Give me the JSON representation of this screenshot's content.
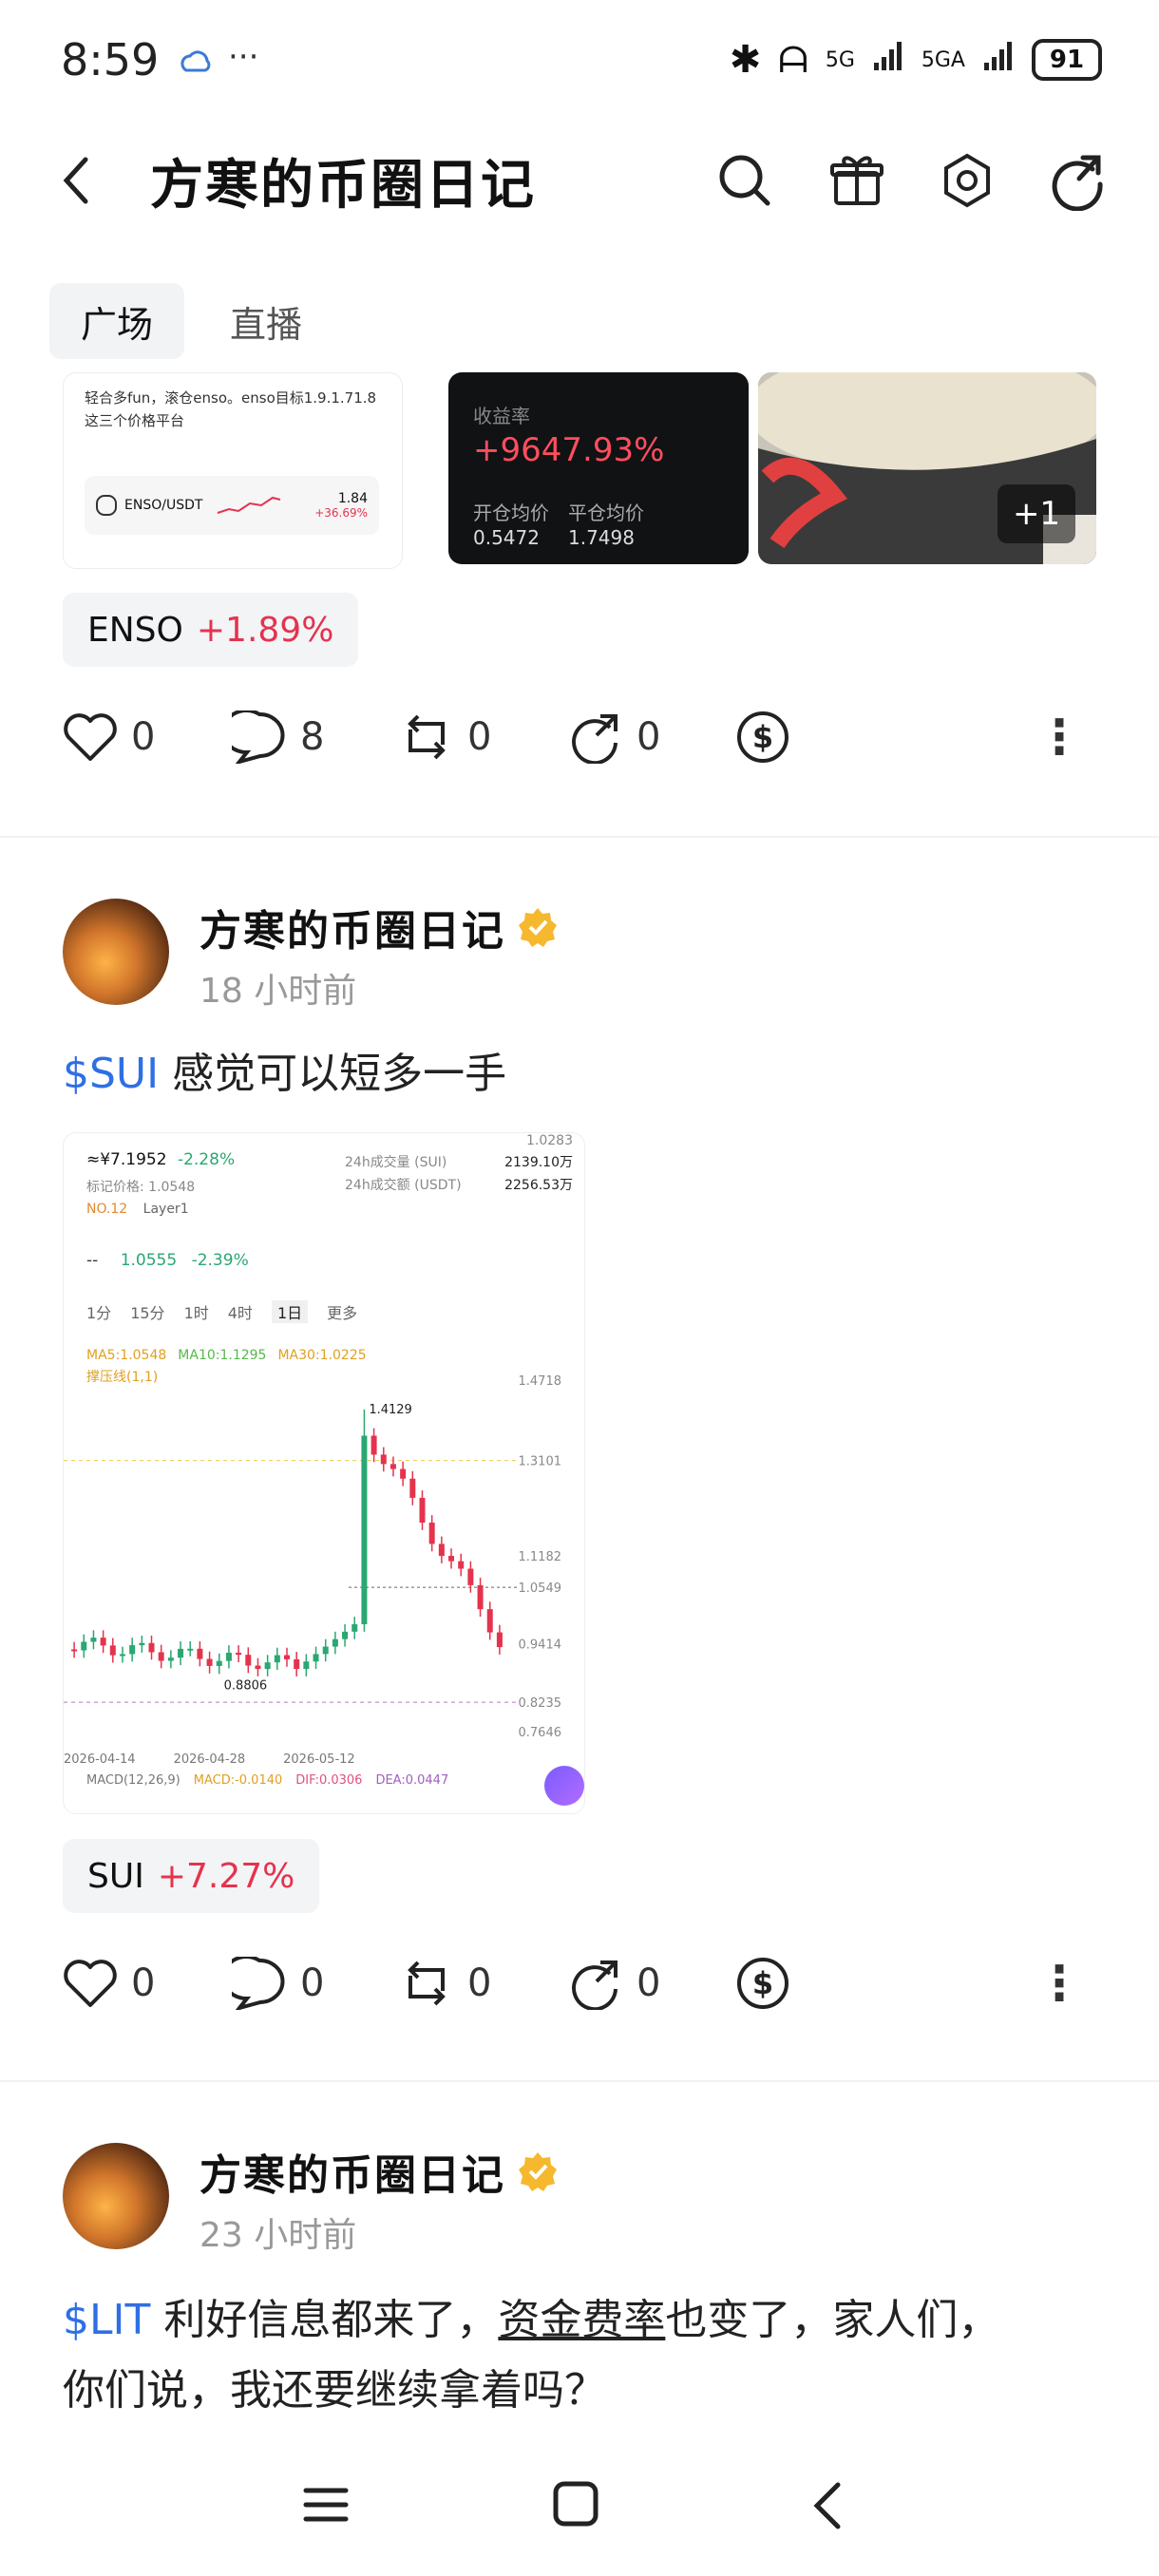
{
  "status_bar": {
    "time": "8:59",
    "more": "···",
    "network1": "5G",
    "network2": "5GA",
    "battery": "91"
  },
  "header": {
    "title": "方寒的币圈日记"
  },
  "tabs": [
    {
      "label": "广场"
    },
    {
      "label": "直播"
    }
  ],
  "post1": {
    "thumb1": {
      "line1": "轻合多fun，滚仓enso。enso目标1.9.1.71.8这三个价格平台",
      "pair": "ENSO/USDT",
      "price": "1.84",
      "change": "+36.69%"
    },
    "thumb2": {
      "label": "收益率",
      "value": "+9647.93%",
      "open_label": "开仓均价",
      "open_value": "0.5472",
      "close_label": "平仓均价",
      "close_value": "1.7498"
    },
    "thumb3": {
      "more": "+1"
    },
    "ticker": {
      "symbol": "ENSO",
      "change": "+1.89%"
    },
    "actions": {
      "likes": "0",
      "comments": "8",
      "reposts": "0",
      "shares": "0"
    }
  },
  "post2": {
    "author": "方寒的币圈日记",
    "time": "18 小时前",
    "cashtag": "$SUI",
    "text": " 感觉可以短多一手",
    "chart": {
      "price_cny": "≈¥7.1952",
      "change": "-2.28%",
      "mark_price": "标记价格: 1.0548",
      "rank": "NO.12",
      "sector": "Layer1",
      "stats": [
        {
          "label": "24h成交量 (SUI)",
          "value": "2139.10万"
        },
        {
          "label": "24h成交额 (USDT)",
          "value": "2256.53万"
        }
      ],
      "stat_top": "1.0283",
      "quote": "1.0555",
      "quote_change": "-2.39%",
      "intervals": [
        "1分",
        "15分",
        "1时",
        "4时",
        "1日",
        "更多"
      ],
      "ma": {
        "ma5": "MA5:1.0548",
        "ma10": "MA10:1.1295",
        "ma30": "MA30:1.0225",
        "sr": "撑压线(1,1)"
      },
      "high_label": "1.4129",
      "low_label": "0.8806",
      "yticks": [
        "1.4718",
        "1.3101",
        "1.1182",
        "1.0549",
        "0.9414",
        "0.8235",
        "0.7646"
      ],
      "dates": [
        "2026-04-14",
        "2026-04-28",
        "2026-05-12"
      ],
      "macd": {
        "name": "MACD(12,26,9)",
        "macd": "MACD:-0.0140",
        "dif": "DIF:0.0306",
        "dea": "DEA:0.0447"
      }
    },
    "ticker": {
      "symbol": "SUI",
      "change": "+7.27%"
    },
    "actions": {
      "likes": "0",
      "comments": "0",
      "reposts": "0",
      "shares": "0"
    }
  },
  "post3": {
    "author": "方寒的币圈日记",
    "time": "23 小时前",
    "cashtag": "$LIT",
    "text_a": " 利好信息都来了，",
    "text_link": "资金费率",
    "text_b": "也变了，家人们，",
    "text_line2": "你们说，我还要继续拿着吗？"
  },
  "chart_data": {
    "type": "candlestick",
    "x": [
      "2026-04-14",
      "2026-04-28",
      "2026-05-12"
    ],
    "high": 1.4129,
    "low": 0.8806,
    "last": 1.0549,
    "ylim": [
      0.7646,
      1.4718
    ],
    "ticks": [
      1.4718,
      1.3101,
      1.1182,
      1.0549,
      0.9414,
      0.8235,
      0.7646
    ]
  }
}
